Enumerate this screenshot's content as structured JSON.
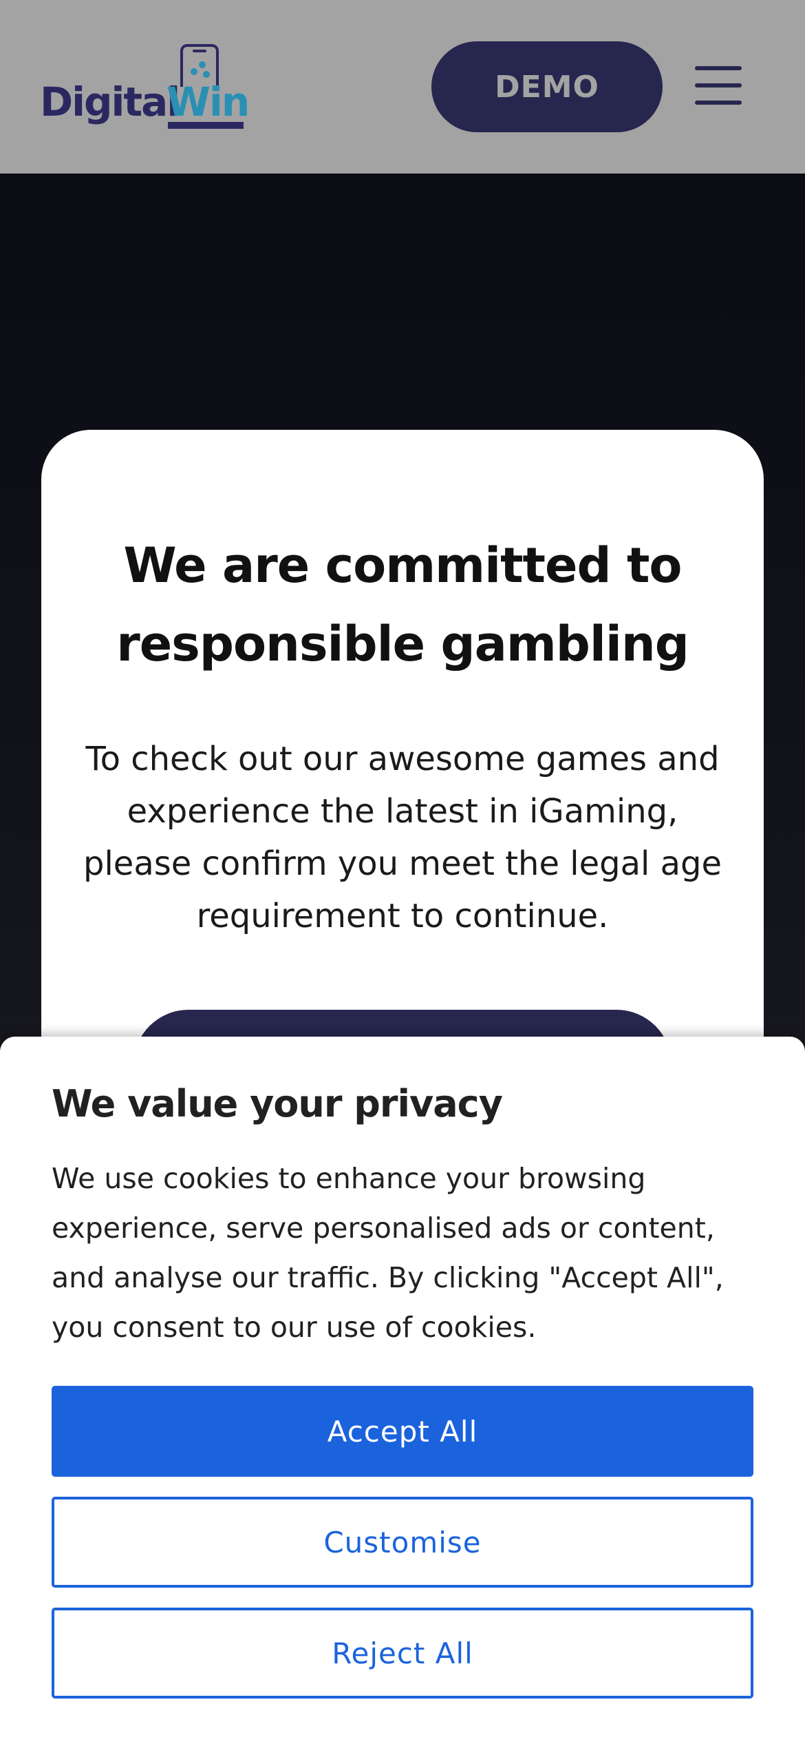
{
  "header": {
    "logo": {
      "text_part1": "Digital",
      "text_part2": "Win",
      "brand_colors": {
        "primary": "#2b2861",
        "accent": "#2a8fb3"
      }
    },
    "demo_label": "DEMO",
    "menu_icon": "hamburger-menu-icon"
  },
  "age_gate": {
    "title": "We are committed to responsible gambling",
    "body": "To check out our awesome games and experience the latest in iGaming, please confirm you meet the legal age requirement to continue."
  },
  "cookie_banner": {
    "title": "We value your privacy",
    "body": "We use cookies to enhance your browsing experience, serve personalised ads or content, and analyse our traffic. By clicking \"Accept All\", you consent to our use of cookies.",
    "accept_label": "Accept All",
    "customise_label": "Customise",
    "reject_label": "Reject All",
    "accent_color": "#1b63dc"
  }
}
